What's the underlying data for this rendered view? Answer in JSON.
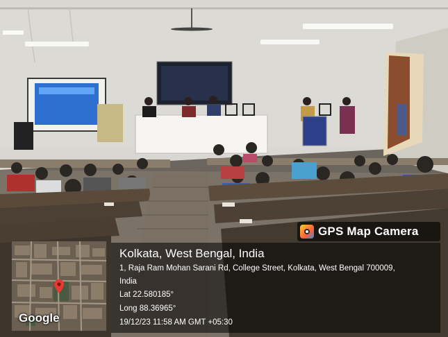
{
  "badge": {
    "icon": "camera-app-icon",
    "label": "GPS Map Camera"
  },
  "location": {
    "title": "Kolkata, West Bengal, India",
    "address_line1": "1, Raja Ram Mohan Sarani Rd, College Street, Kolkata, West Bengal 700009,",
    "address_line2": "India",
    "lat": "Lat 22.580185°",
    "long": "Long 88.36965°",
    "datetime": "19/12/23 11:58 AM GMT +05:30"
  },
  "map": {
    "provider": "Google",
    "pin_color": "#e53935"
  }
}
